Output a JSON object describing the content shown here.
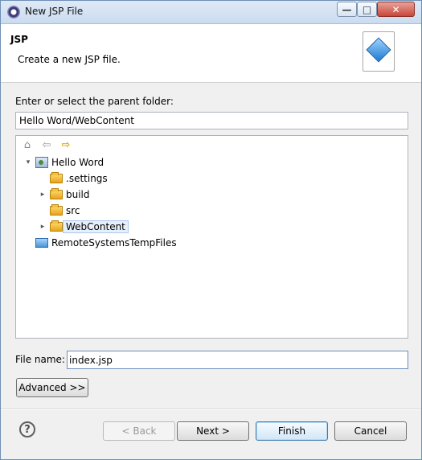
{
  "window": {
    "title": "New JSP File"
  },
  "header": {
    "title": "JSP",
    "description": "Create a new JSP file."
  },
  "parent_folder": {
    "label": "Enter or select the parent folder:",
    "value": "Hello Word/WebContent"
  },
  "tree": {
    "items": [
      {
        "label": "Hello Word"
      },
      {
        "label": ".settings"
      },
      {
        "label": "build"
      },
      {
        "label": "src"
      },
      {
        "label": "WebContent"
      },
      {
        "label": "RemoteSystemsTempFiles"
      }
    ]
  },
  "file_name": {
    "label": "File name:",
    "value": "index.jsp"
  },
  "buttons": {
    "advanced": "Advanced >>",
    "back": "< Back",
    "next": "Next >",
    "finish": "Finish",
    "cancel": "Cancel",
    "help": "?"
  },
  "icons": {
    "home": "home-icon",
    "back": "back-arrow-icon",
    "forward": "forward-arrow-icon",
    "folder": "folder-icon",
    "project": "project-icon"
  }
}
